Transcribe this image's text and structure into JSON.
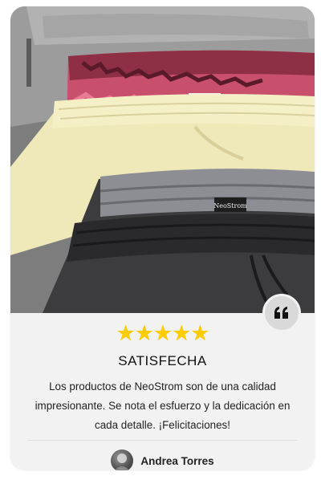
{
  "review": {
    "rating": 5,
    "stars": "★★★★★",
    "title": "SATISFECHA",
    "text": "Los productos de NeoStrom son de una calidad impresionante. Se nota el esfuerzo y la dedicación en cada detalle. ¡Felicitaciones!",
    "author": "Andrea Torres"
  },
  "photo": {
    "label_brand": "NeoStrom"
  },
  "colors": {
    "star": "#ffcc00",
    "card_bg": "#f2f2f2",
    "badge_bg": "#d9d9d9"
  },
  "icons": {
    "quote": "quote-icon",
    "avatar": "avatar"
  }
}
